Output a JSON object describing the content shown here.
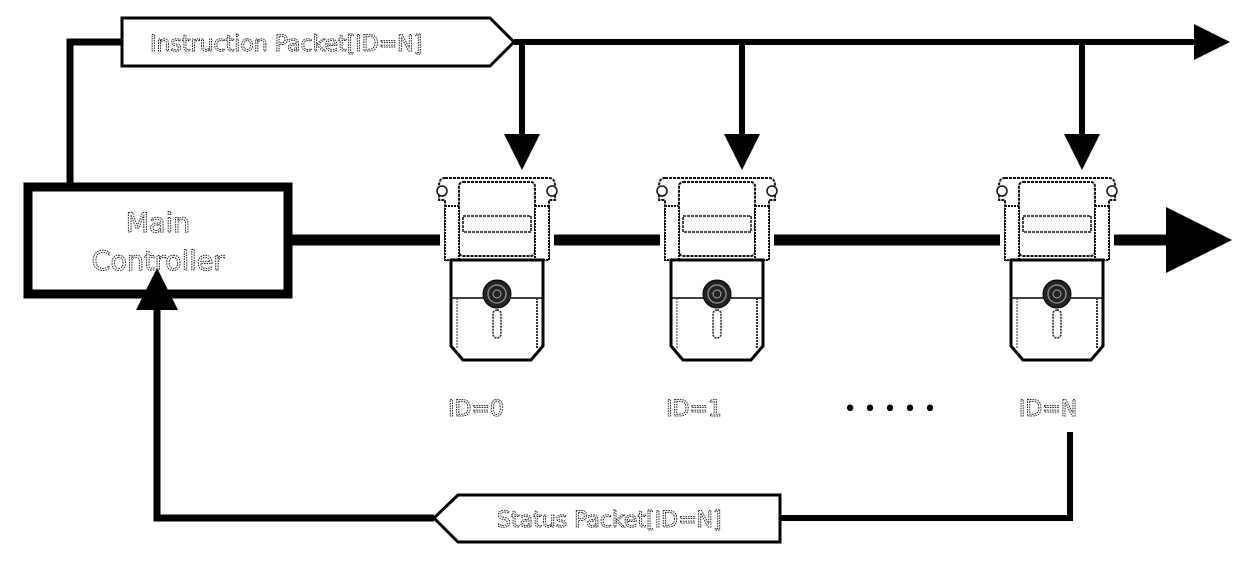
{
  "diagram": {
    "controller": {
      "line1": "Main",
      "line2": "Controller"
    },
    "instruction_packet": {
      "label": "Instruction Packet[ID=N]"
    },
    "status_packet": {
      "label": "Status Packet[ID=N]"
    },
    "servos": [
      {
        "id_label": "ID=0"
      },
      {
        "id_label": "ID=1"
      },
      {
        "id_label": "ID=N"
      }
    ],
    "ellipsis": "• • • • •",
    "colors": {
      "line": "#000000",
      "background": "#ffffff",
      "outline": "#222222"
    }
  }
}
